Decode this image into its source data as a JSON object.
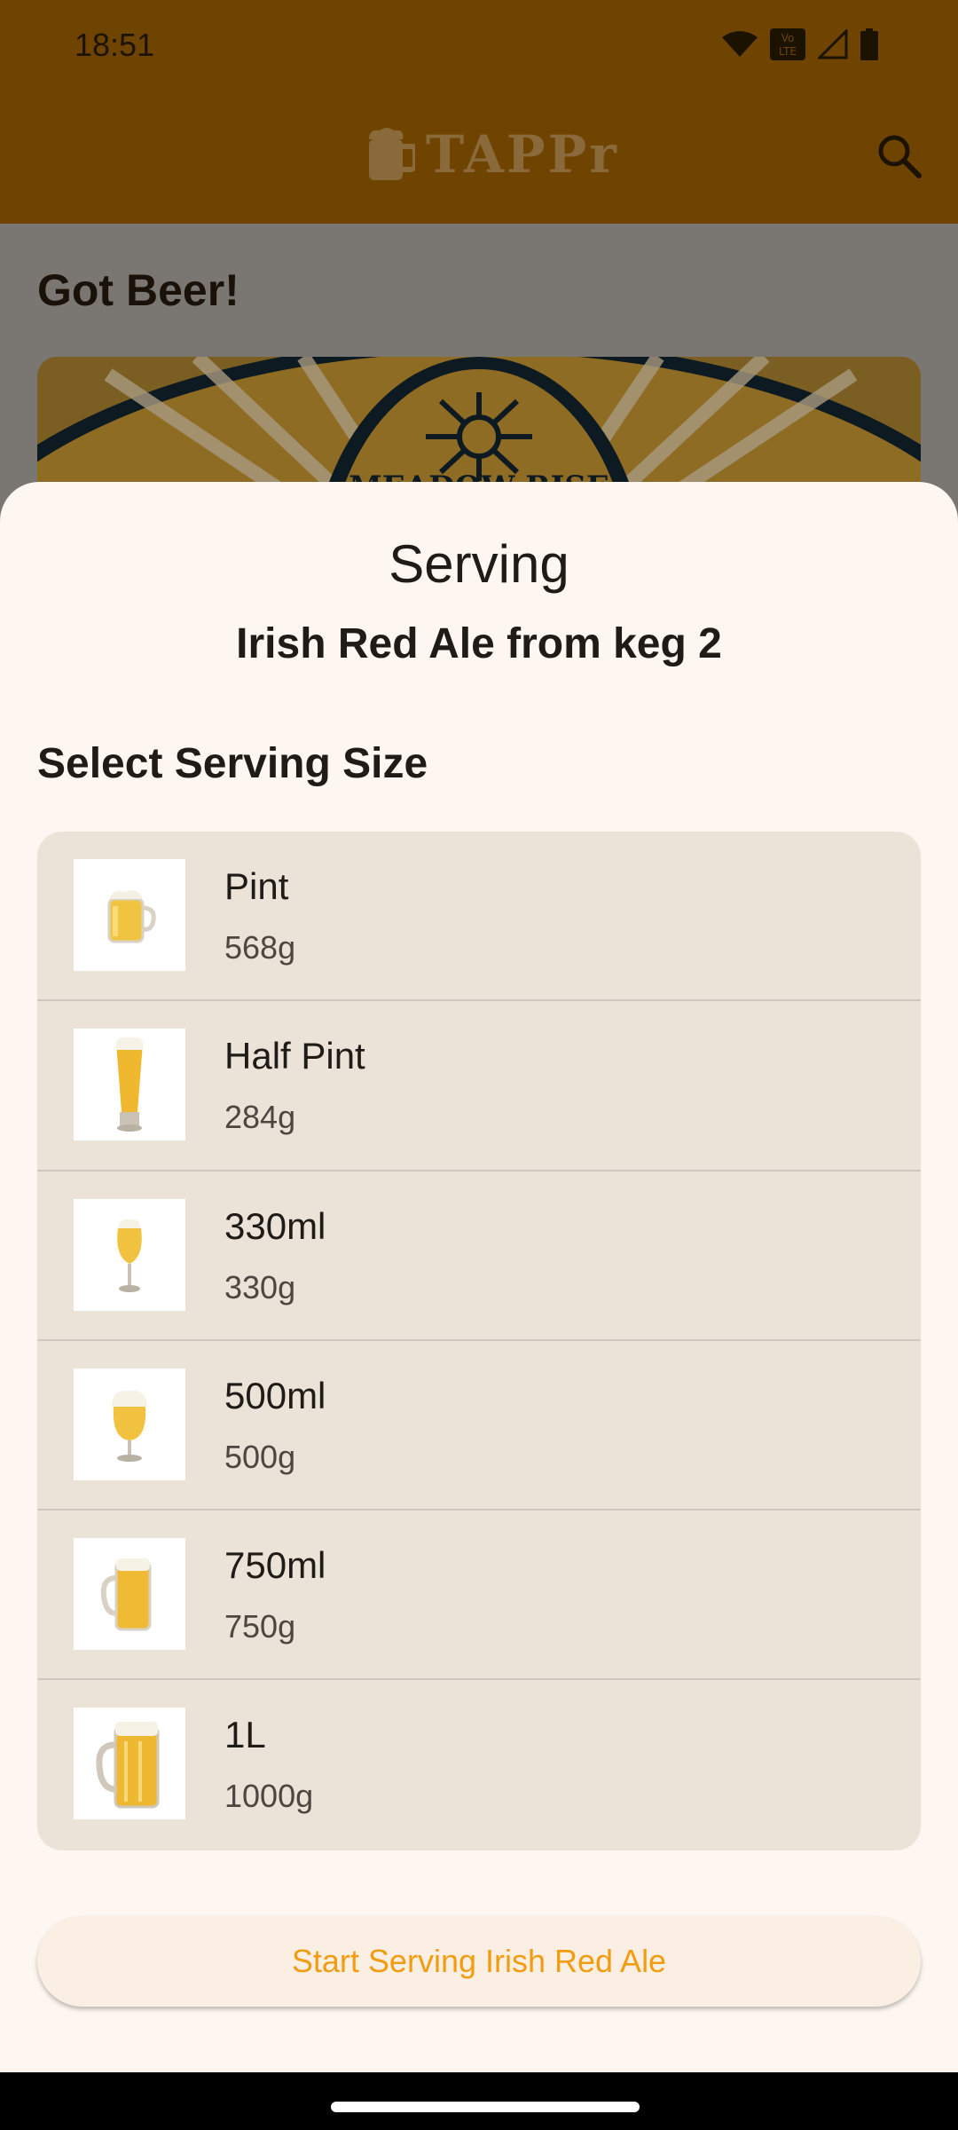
{
  "status_bar": {
    "time": "18:51",
    "icons": [
      "wifi-icon",
      "volte-icon",
      "signal-icon",
      "battery-icon"
    ]
  },
  "app_bar": {
    "logo_text": "TAPPr",
    "logo_icon": "beer-mug-icon",
    "search_icon": "search-icon",
    "color": "#6f4400"
  },
  "background_page": {
    "heading": "Got Beer!",
    "banner_text": "MEADOW RISE"
  },
  "sheet": {
    "title": "Serving",
    "subtitle": "Irish Red Ale from keg 2",
    "section_label": "Select Serving Size",
    "sizes": [
      {
        "name": "Pint",
        "weight": "568g",
        "icon": "pint-mug-icon"
      },
      {
        "name": "Half Pint",
        "weight": "284g",
        "icon": "pilsner-glass-icon"
      },
      {
        "name": "330ml",
        "weight": "330g",
        "icon": "tulip-glass-icon"
      },
      {
        "name": "500ml",
        "weight": "500g",
        "icon": "goblet-glass-icon"
      },
      {
        "name": "750ml",
        "weight": "750g",
        "icon": "stein-mug-icon"
      },
      {
        "name": "1L",
        "weight": "1000g",
        "icon": "litre-mug-icon"
      }
    ],
    "start_button": "Start Serving Irish Red Ale",
    "accent_color": "#f29c11"
  }
}
